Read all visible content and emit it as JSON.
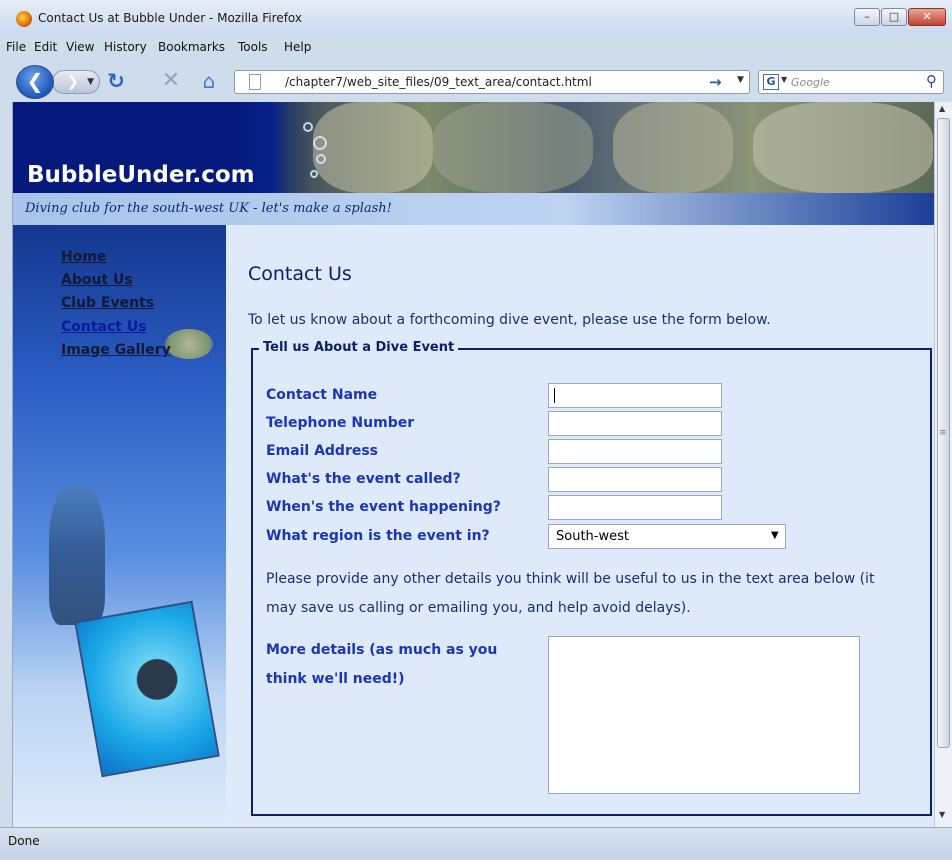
{
  "window": {
    "title": "Contact Us at Bubble Under - Mozilla Firefox"
  },
  "menu": [
    "File",
    "Edit",
    "View",
    "History",
    "Bookmarks",
    "Tools",
    "Help"
  ],
  "nav": {
    "url": "/chapter7/web_site_files/09_text_area/contact.html",
    "search_placeholder": "Google"
  },
  "site": {
    "logo": "BubbleUnder.com",
    "tagline": "Diving club for the south-west UK - let's make a splash!",
    "nav_links": [
      "Home",
      "About Us",
      "Club Events",
      "Contact Us",
      "Image Gallery"
    ],
    "active_link": "Contact Us"
  },
  "page": {
    "heading": "Contact Us",
    "intro": "To let us know about a forthcoming dive event, please use the form below."
  },
  "form": {
    "legend": "Tell us About a Dive Event",
    "fields": [
      {
        "label": "Contact Name",
        "value": ""
      },
      {
        "label": "Telephone Number",
        "value": ""
      },
      {
        "label": "Email Address",
        "value": ""
      },
      {
        "label": "What's the event called?",
        "value": ""
      },
      {
        "label": "When's the event happening?",
        "value": ""
      }
    ],
    "region_label": "What region is the event in?",
    "region_value": "South-west",
    "details_text": "Please provide any other details you think will be useful to us in the text area below (it may save us calling or emailing you, and help avoid delays).",
    "more_label": "More details (as much as you think we'll need!)",
    "more_value": ""
  },
  "status": "Done"
}
